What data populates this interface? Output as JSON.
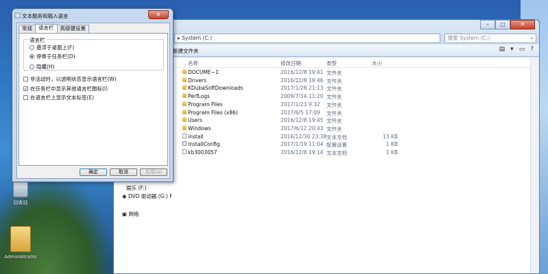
{
  "desktop": {
    "icons": [
      {
        "label": "回收站"
      },
      {
        "label": "Administrator"
      }
    ]
  },
  "explorer": {
    "address": "System (C:)",
    "address_arrow": "▸",
    "search_placeholder": "搜索 System (C:)",
    "command_new_folder": "新建文件夹",
    "columns": {
      "name": "名称",
      "date": "修改日期",
      "type": "类型",
      "size": "大小"
    },
    "nav": [
      {
        "label": "娱乐 (F:)"
      },
      {
        "label": "DVD 驱动器 (G:) M"
      },
      {
        "label": "网络"
      }
    ],
    "files": [
      {
        "name": "DOCUME~1",
        "date": "2016/12/8 19:41",
        "type": "文件夹",
        "size": "",
        "icon": "folder"
      },
      {
        "name": "Drivers",
        "date": "2016/12/8 19:46",
        "type": "文件夹",
        "size": "",
        "icon": "folder"
      },
      {
        "name": "KDubaSoftDownloads",
        "date": "2017/1/28 21:13",
        "type": "文件夹",
        "size": "",
        "icon": "folder"
      },
      {
        "name": "PerfLogs",
        "date": "2009/7/14 11:20",
        "type": "文件夹",
        "size": "",
        "icon": "folder"
      },
      {
        "name": "Program Files",
        "date": "2017/1/23 9:32",
        "type": "文件夹",
        "size": "",
        "icon": "folder"
      },
      {
        "name": "Program Files (x86)",
        "date": "2017/6/5 17:09",
        "type": "文件夹",
        "size": "",
        "icon": "folder"
      },
      {
        "name": "Users",
        "date": "2016/12/8 19:45",
        "type": "文件夹",
        "size": "",
        "icon": "folder"
      },
      {
        "name": "Windows",
        "date": "2017/6/12 20:43",
        "type": "文件夹",
        "size": "",
        "icon": "folder"
      },
      {
        "name": "install",
        "date": "2016/12/30 23:38",
        "type": "文本文档",
        "size": "13 KB",
        "icon": "text-document"
      },
      {
        "name": "InstallConfig",
        "date": "2017/1/19 11:04",
        "type": "配置设置",
        "size": "1 KB",
        "icon": "config-file"
      },
      {
        "name": "kb3003057",
        "date": "2016/12/8 19:14",
        "type": "文本文档",
        "size": "1 KB",
        "icon": "text-document"
      }
    ]
  },
  "dialog": {
    "title": "文本服务和输入语言",
    "close_label": "✕",
    "tabs": [
      {
        "label": "常规",
        "active": false
      },
      {
        "label": "语言栏",
        "active": true
      },
      {
        "label": "高级键设置",
        "active": false
      }
    ],
    "group_title": "语言栏",
    "radios": [
      {
        "label": "悬浮于桌面上(F)",
        "checked": false
      },
      {
        "label": "停靠于任务栏(D)",
        "checked": true
      },
      {
        "label": "隐藏(H)",
        "checked": false
      }
    ],
    "checkboxes": [
      {
        "label": "非活动时，以透明状态显示语言栏(W)",
        "checked": false
      },
      {
        "label": "在任务栏中显示其他语言栏图标(I)",
        "checked": true
      },
      {
        "label": "在语言栏上显示文本标签(E)",
        "checked": false
      }
    ],
    "buttons": {
      "ok": "确定",
      "cancel": "取消",
      "apply": "应用(A)"
    }
  }
}
